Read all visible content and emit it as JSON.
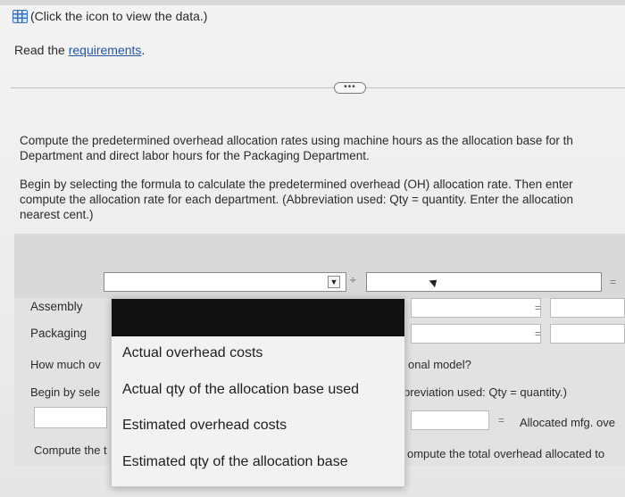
{
  "header": {
    "data_link_text": "(Click the icon to view the data.)",
    "read_prefix": "Read the ",
    "requirements_link": "requirements",
    "read_suffix": "."
  },
  "more_button": "•••",
  "instructions": {
    "line1a": "Compute the predetermined overhead allocation rates using machine hours as the allocation base for th",
    "line1b": "Department and direct labor hours for the Packaging Department.",
    "line2a": "Begin by selecting the formula to calculate the predetermined overhead (OH) allocation rate. Then enter",
    "line2b": "compute the allocation rate for each department. (Abbreviation used: Qty = quantity. Enter the allocation",
    "line2c": "nearest cent.)"
  },
  "formula": {
    "operator": "÷",
    "equals": "="
  },
  "rows": {
    "assembly": "Assembly",
    "packaging": "Packaging"
  },
  "lower": {
    "question_left": "How much ov",
    "question_right": "onal model?",
    "begin_left": "Begin by sele",
    "begin_right": "previation used: Qty = quantity.)",
    "allocated_label": "Allocated mfg. ove",
    "compute_left": "Compute the t",
    "compute_right": "ompute the total overhead allocated to"
  },
  "dropdown": {
    "options": [
      "Actual overhead costs",
      "Actual qty of the allocation base used",
      "Estimated overhead costs",
      "Estimated qty of the allocation base"
    ]
  }
}
